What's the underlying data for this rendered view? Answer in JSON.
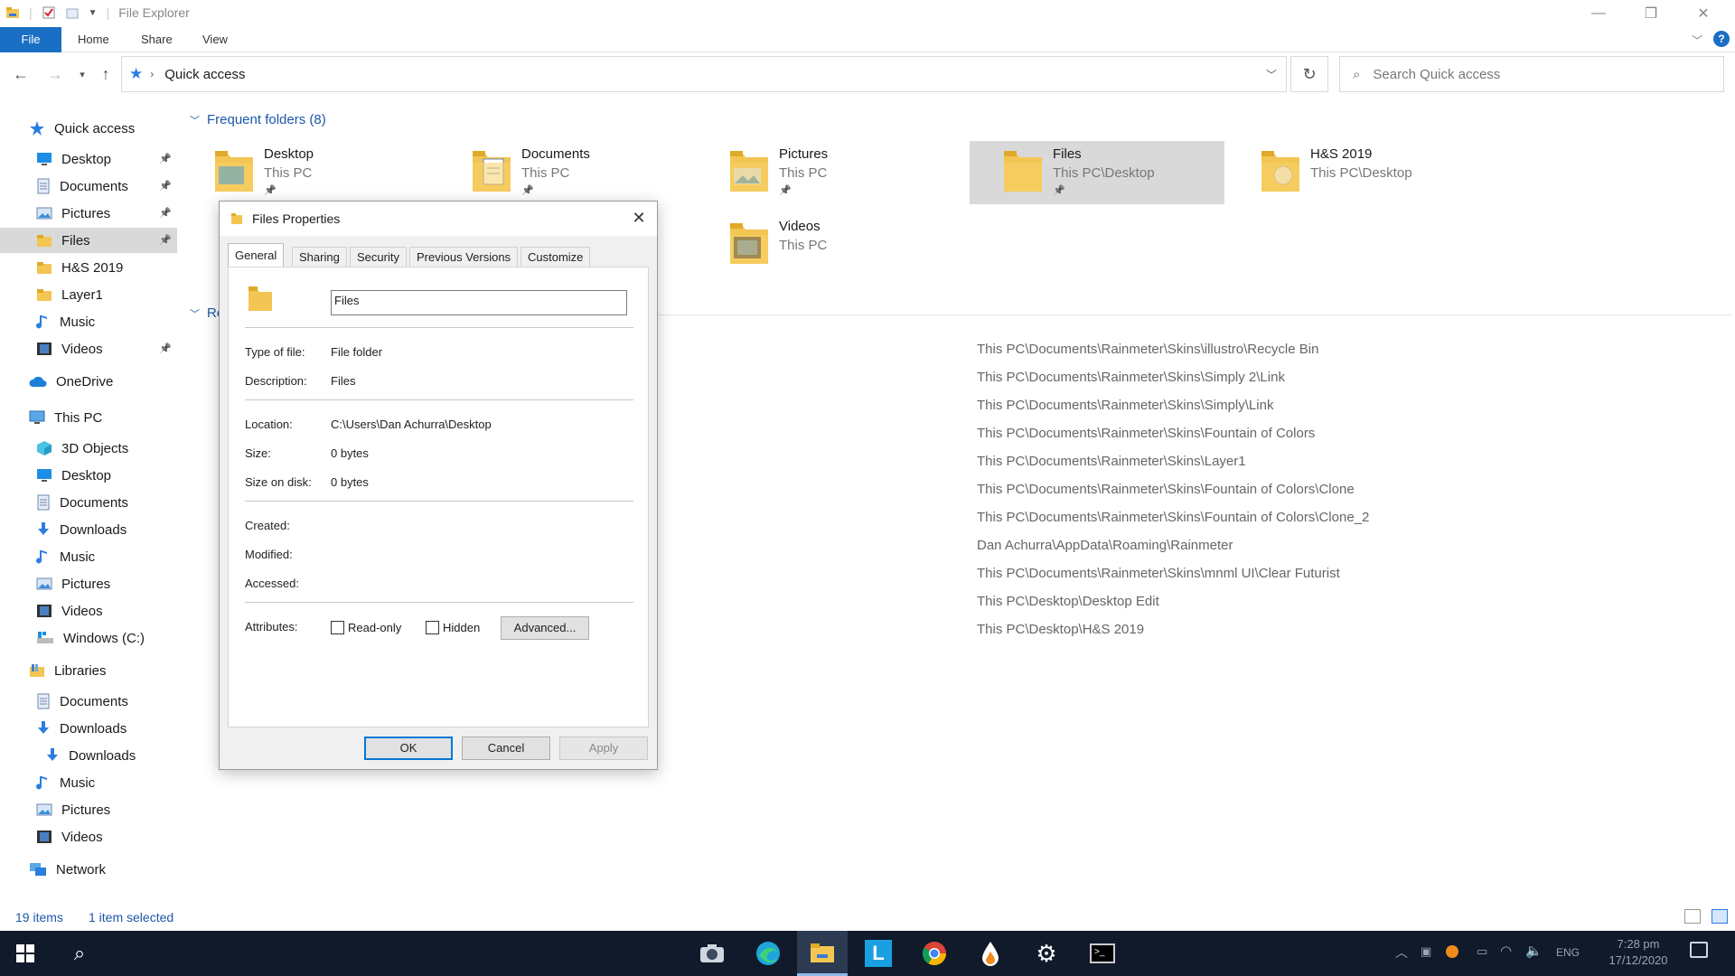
{
  "window": {
    "title": "File Explorer"
  },
  "ribbon": {
    "tabs": [
      "File",
      "Home",
      "Share",
      "View"
    ]
  },
  "address": {
    "path": "Quick access",
    "search_placeholder": "Search Quick access"
  },
  "sidebar": {
    "items": [
      {
        "label": "Quick access",
        "icon": "star-icon",
        "indent": 0,
        "pinned": false,
        "top": 0
      },
      {
        "label": "Desktop",
        "icon": "desktop-icon",
        "indent": 1,
        "pinned": true
      },
      {
        "label": "Documents",
        "icon": "documents-icon",
        "indent": 1,
        "pinned": true
      },
      {
        "label": "Pictures",
        "icon": "pictures-icon",
        "indent": 1,
        "pinned": true
      },
      {
        "label": "Files",
        "icon": "folder-icon",
        "indent": 1,
        "pinned": true,
        "selected": true
      },
      {
        "label": "H&S 2019",
        "icon": "folder-icon",
        "indent": 1,
        "pinned": false
      },
      {
        "label": "Layer1",
        "icon": "folder-icon",
        "indent": 1,
        "pinned": false
      },
      {
        "label": "Music",
        "icon": "music-icon",
        "indent": 1,
        "pinned": false
      },
      {
        "label": "Videos",
        "icon": "videos-icon",
        "indent": 1,
        "pinned": true
      },
      {
        "label": "OneDrive",
        "icon": "onedrive-icon",
        "indent": 0,
        "pinned": false
      },
      {
        "label": "This PC",
        "icon": "pc-icon",
        "indent": 0,
        "pinned": false
      },
      {
        "label": "3D Objects",
        "icon": "cube-icon",
        "indent": 1,
        "pinned": false
      },
      {
        "label": "Desktop",
        "icon": "desktop-icon",
        "indent": 1,
        "pinned": false
      },
      {
        "label": "Documents",
        "icon": "documents-icon",
        "indent": 1,
        "pinned": false
      },
      {
        "label": "Downloads",
        "icon": "downloads-icon",
        "indent": 1,
        "pinned": false
      },
      {
        "label": "Music",
        "icon": "music-icon",
        "indent": 1,
        "pinned": false
      },
      {
        "label": "Pictures",
        "icon": "pictures-icon",
        "indent": 1,
        "pinned": false
      },
      {
        "label": "Videos",
        "icon": "videos-icon",
        "indent": 1,
        "pinned": false
      },
      {
        "label": "Windows (C:)",
        "icon": "drive-icon",
        "indent": 1,
        "pinned": false
      },
      {
        "label": "Libraries",
        "icon": "libraries-icon",
        "indent": 0,
        "pinned": false
      },
      {
        "label": "Documents",
        "icon": "documents-icon",
        "indent": 1,
        "pinned": false
      },
      {
        "label": "Downloads",
        "icon": "downloads-icon",
        "indent": 1,
        "pinned": false
      },
      {
        "label": "Downloads",
        "icon": "downloads-icon",
        "indent": 2,
        "pinned": false
      },
      {
        "label": "Music",
        "icon": "music-icon",
        "indent": 1,
        "pinned": false
      },
      {
        "label": "Pictures",
        "icon": "pictures-icon",
        "indent": 1,
        "pinned": false
      },
      {
        "label": "Videos",
        "icon": "videos-icon",
        "indent": 1,
        "pinned": false
      },
      {
        "label": "Network",
        "icon": "network-icon",
        "indent": 0,
        "pinned": false
      }
    ]
  },
  "frequent": {
    "heading": "Frequent folders (8)",
    "folders": [
      {
        "name": "Desktop",
        "location": "This PC",
        "pinned": true
      },
      {
        "name": "Documents",
        "location": "This PC",
        "pinned": true
      },
      {
        "name": "Pictures",
        "location": "This PC",
        "pinned": true
      },
      {
        "name": "Files",
        "location": "This PC\\Desktop",
        "pinned": true,
        "selected": true
      },
      {
        "name": "H&S 2019",
        "location": "This PC\\Desktop",
        "pinned": false
      },
      {
        "name": "Videos",
        "location": "This PC",
        "pinned": false
      }
    ]
  },
  "recent": {
    "heading_partial": "Re",
    "paths": [
      "This PC\\Documents\\Rainmeter\\Skins\\illustro\\Recycle Bin",
      "This PC\\Documents\\Rainmeter\\Skins\\Simply 2\\Link",
      "This PC\\Documents\\Rainmeter\\Skins\\Simply\\Link",
      "This PC\\Documents\\Rainmeter\\Skins\\Fountain of Colors",
      "This PC\\Documents\\Rainmeter\\Skins\\Layer1",
      "This PC\\Documents\\Rainmeter\\Skins\\Fountain of Colors\\Clone",
      "This PC\\Documents\\Rainmeter\\Skins\\Fountain of Colors\\Clone_2",
      "Dan Achurra\\AppData\\Roaming\\Rainmeter",
      "This PC\\Documents\\Rainmeter\\Skins\\mnml UI\\Clear Futurist",
      "This PC\\Desktop\\Desktop Edit",
      "This PC\\Desktop\\H&S 2019"
    ]
  },
  "status": {
    "count": "19 items",
    "selection": "1 item selected"
  },
  "dialog": {
    "title": "Files Properties",
    "tabs": [
      "General",
      "Sharing",
      "Security",
      "Previous Versions",
      "Customize"
    ],
    "name_value": "Files",
    "type_label": "Type of file:",
    "type_value": "File folder",
    "desc_label": "Description:",
    "desc_value": "Files",
    "location_label": "Location:",
    "location_value": "C:\\Users\\Dan Achurra\\Desktop",
    "size_label": "Size:",
    "size_value": "0 bytes",
    "sizeondisk_label": "Size on disk:",
    "sizeondisk_value": "0 bytes",
    "created_label": "Created:",
    "modified_label": "Modified:",
    "accessed_label": "Accessed:",
    "attributes_label": "Attributes:",
    "readonly_label": "Read-only",
    "hidden_label": "Hidden",
    "advanced_label": "Advanced...",
    "ok_label": "OK",
    "cancel_label": "Cancel",
    "apply_label": "Apply"
  },
  "taskbar": {
    "language": "ENG",
    "time": "7:28 pm",
    "date": "17/12/2020"
  },
  "colors": {
    "accent": "#1a6fc4",
    "folder": "#f3c653",
    "taskbar": "#101a2a"
  }
}
